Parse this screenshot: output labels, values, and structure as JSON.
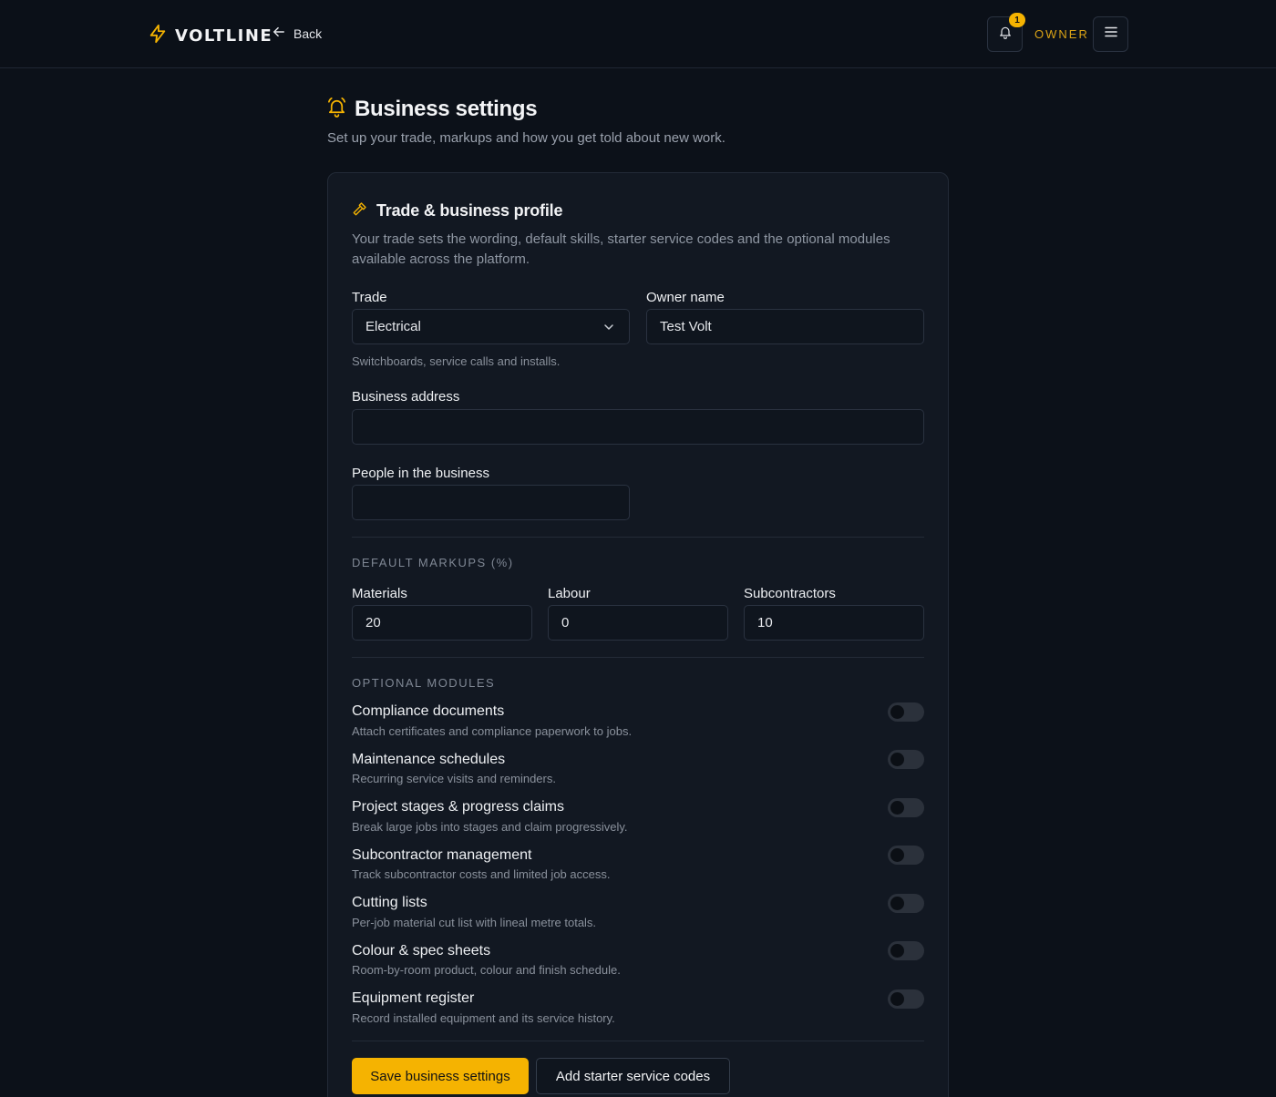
{
  "header": {
    "brand": "VOLTLINE",
    "back_label": "Back",
    "notification_count": "1",
    "role": "OWNER",
    "accent_color": "#f5b301"
  },
  "page": {
    "title": "Business settings",
    "subtitle": "Set up your trade, markups and how you get told about new work."
  },
  "profile": {
    "title": "Trade & business profile",
    "description": "Your trade sets the wording, default skills, starter service codes and the optional modules available across the platform.",
    "trade_label": "Trade",
    "trade_value": "Electrical",
    "trade_hint": "Switchboards, service calls and installs.",
    "owner_label": "Owner name",
    "owner_value": "Test Volt",
    "address_label": "Business address",
    "address_value": "",
    "people_label": "People in the business",
    "people_value": ""
  },
  "markups": {
    "heading": "DEFAULT MARKUPS (%)",
    "materials_label": "Materials",
    "materials_value": "20",
    "labour_label": "Labour",
    "labour_value": "0",
    "subcontractors_label": "Subcontractors",
    "subcontractors_value": "10"
  },
  "modules": {
    "heading": "OPTIONAL MODULES",
    "items": [
      {
        "title": "Compliance documents",
        "desc": "Attach certificates and compliance paperwork to jobs.",
        "enabled": false
      },
      {
        "title": "Maintenance schedules",
        "desc": "Recurring service visits and reminders.",
        "enabled": false
      },
      {
        "title": "Project stages & progress claims",
        "desc": "Break large jobs into stages and claim progressively.",
        "enabled": false
      },
      {
        "title": "Subcontractor management",
        "desc": "Track subcontractor costs and limited job access.",
        "enabled": false
      },
      {
        "title": "Cutting lists",
        "desc": "Per-job material cut list with lineal metre totals.",
        "enabled": false
      },
      {
        "title": "Colour & spec sheets",
        "desc": "Room-by-room product, colour and finish schedule.",
        "enabled": false
      },
      {
        "title": "Equipment register",
        "desc": "Record installed equipment and its service history.",
        "enabled": false
      }
    ]
  },
  "actions": {
    "save_label": "Save business settings",
    "starter_label": "Add starter service codes"
  },
  "icons": {
    "brand": "lightning-bolt-icon",
    "back": "arrow-left-icon",
    "notifications": "bell-icon",
    "menu": "hamburger-menu-icon",
    "page": "bell-ring-icon",
    "section": "hammer-icon",
    "select": "chevron-down-icon"
  }
}
